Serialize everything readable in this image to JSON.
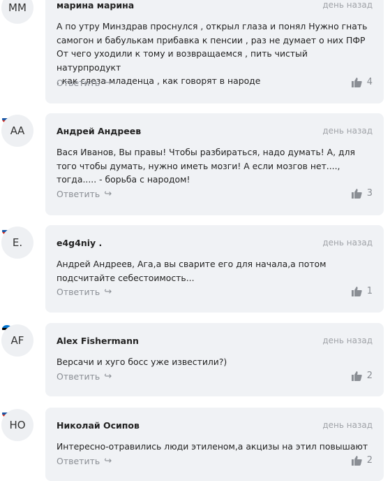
{
  "comments": [
    {
      "avatar": "ММ",
      "flag": null,
      "author": "марина марина",
      "time": "день назад",
      "text": "А по утру Минздрав проснулся  , открыл глаза  и понял Нужно гнать\nсамогон и бабулькам прибавка к пенсии , раз не думает о них ПФР\nОт чего уходили к тому и возвращаемся , пить чистый натурпродукт\n, как слеза младенца , как говорят в народе",
      "reply": "Ответить",
      "likes": "4"
    },
    {
      "avatar": "АА",
      "flag": "ru",
      "author": "Андрей Андреев",
      "time": "день назад",
      "text": "Вася Иванов, Вы правы! Чтобы разбираться, надо думать! А, для\nтого чтобы думать, нужно иметь мозги! А если мозгов нет....,\nтогда..... - борьба с народом!",
      "reply": "Ответить",
      "likes": "3"
    },
    {
      "avatar": "E.",
      "flag": "ru",
      "author": "e4g4niy .",
      "time": "день назад",
      "text": "Андрей Андреев, Ага,а вы  сварите его для начала,а потом\nподсчитайте себестоимость...",
      "reply": "Ответить",
      "likes": "1"
    },
    {
      "avatar": "AF",
      "flag": "ee",
      "author": "Alex Fishermann",
      "time": "день назад",
      "text": "Версачи и хуго босс уже известили?)",
      "reply": "Ответить",
      "likes": "2"
    },
    {
      "avatar": "НО",
      "flag": "ru",
      "author": "Николай Осипов",
      "time": "день назад",
      "text": "Интересно-отравились люди этиленом,а акцизы на этил повышают",
      "reply": "Ответить",
      "likes": "2"
    }
  ],
  "flag_colors": {
    "ru": [
      "#ffffff",
      "#1c57a5",
      "#d52b1e"
    ],
    "ee": [
      "#0072ce",
      "#000000",
      "#ffffff"
    ]
  },
  "icons": {
    "like": "thumbs-up-icon",
    "reply": "reply-arrow-icon"
  }
}
